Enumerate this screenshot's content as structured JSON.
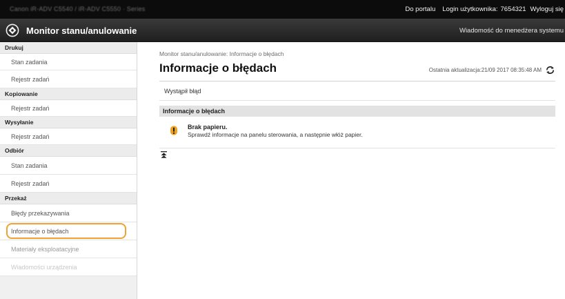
{
  "topbar": {
    "blurred_text": "Canon iR-ADV C5540 / iR-ADV C5550 · Series",
    "portal_link": "Do portalu",
    "login_label": "Login użytkownika:",
    "login_value": "7654321",
    "logout_link": "Wyloguj się"
  },
  "appbar": {
    "icon": "status-monitor-icon",
    "title": "Monitor stanu/anulowanie",
    "message_link": "Wiadomość do menedżera systemu"
  },
  "sidebar": {
    "groups": [
      {
        "header": "Drukuj",
        "items": [
          "Stan zadania",
          "Rejestr zadań"
        ]
      },
      {
        "header": "Kopiowanie",
        "items": [
          "Rejestr zadań"
        ]
      },
      {
        "header": "Wysyłanie",
        "items": [
          "Rejestr zadań"
        ]
      },
      {
        "header": "Odbiór",
        "items": [
          "Stan zadania",
          "Rejestr zadań"
        ]
      },
      {
        "header": "Przekaż",
        "items": [
          "Błędy przekazywania",
          "Informacje o błędach",
          "Materiały eksploatacyjne",
          "Wiadomości urządzenia"
        ]
      }
    ]
  },
  "main": {
    "breadcrumb": "Monitor stanu/anulowanie: Informacje o błędach",
    "title": "Informacje o błędach",
    "last_update": "Ostatnia aktualizacja:21/09 2017 08:35:48 AM",
    "error_text": "Wystąpił błąd",
    "section_header": "Informacje o błędach",
    "error": {
      "icon": "warning-icon",
      "title": "Brak papieru.",
      "description": "Sprawdź informacje na panelu sterowania, a następnie włóż papier."
    },
    "to_top_icon": "to-top-icon"
  },
  "colors": {
    "topbar_bg": "#0c0c0c",
    "appbar_bg": "#2a2a2a",
    "highlight": "#f1a133",
    "warning": "#f0a21a",
    "section_bg": "#e2e2e2"
  }
}
